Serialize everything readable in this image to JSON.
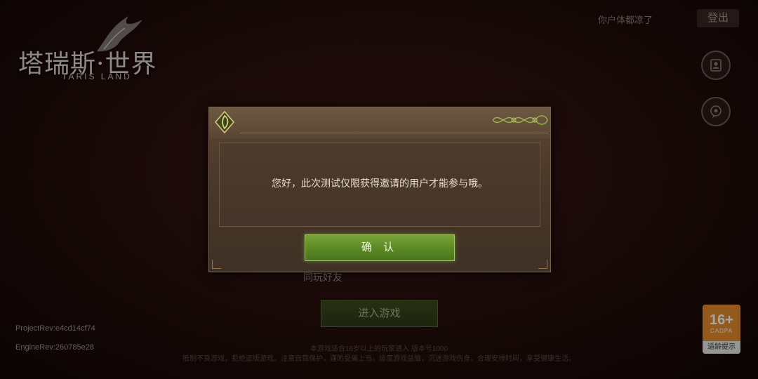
{
  "logo": {
    "title": "塔瑞斯·世界",
    "subtitle": "TARIS LAND"
  },
  "header": {
    "username": "你户体都凉了",
    "logout_label": "登出",
    "side_icons": [
      "profile-card-icon",
      "support-chat-icon"
    ]
  },
  "main": {
    "friends_label": "同玩好友",
    "enter_game_label": "进入游戏"
  },
  "build_info": {
    "project_rev": "ProjectRev:e4cd14cf74",
    "engine_rev": "EngineRev:260785e28"
  },
  "footer": {
    "age_notice": "本游戏适合16岁以上的玩家进入  版本号1000",
    "health_notice": "抵制不良游戏，拒绝盗版游戏。注意自我保护，谨防受骗上当。适度游戏益脑，沉迷游戏伤身。合理安排时间，享受健康生活。"
  },
  "age_rating": {
    "age": "16+",
    "org": "CADPA",
    "caption": "适龄提示",
    "color": "#e48a2a"
  },
  "dialog": {
    "message": "您好，此次测试仅限获得邀请的用户才能参与哦。",
    "confirm_label": "确 认",
    "accent_color": "#6b9a2e"
  }
}
